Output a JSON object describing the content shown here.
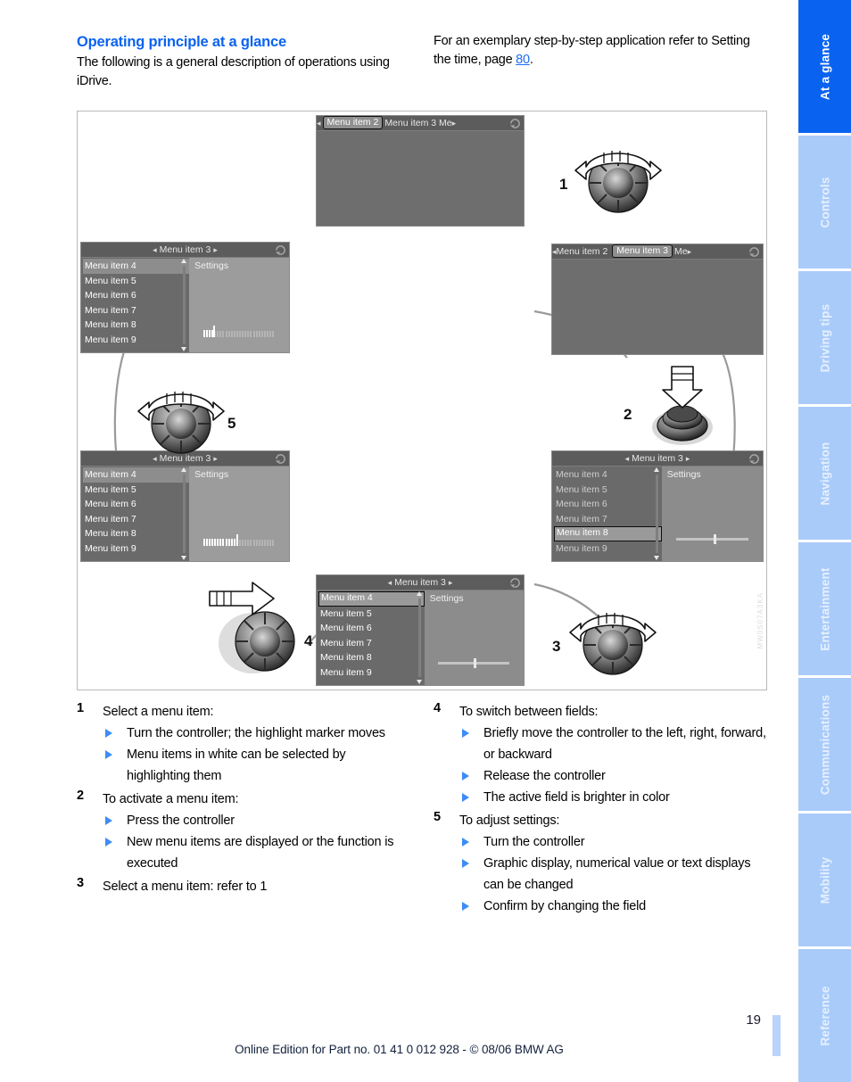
{
  "intro": {
    "heading": "Operating principle at a glance",
    "left_body": "The following is a general description of operations using iDrive.",
    "right_body_before": "For an exemplary step-by-step application refer to Setting the time, page ",
    "right_page_link": "80",
    "right_body_after": "."
  },
  "figure": {
    "watermark": "MW0S07A3KA",
    "screens": [
      {
        "id": "top-center",
        "type": "tab-bar",
        "tabs": [
          "Menu item 2",
          "Menu item 3",
          "Me"
        ],
        "selected_tab": "Menu item 2",
        "left_arrow": "◂",
        "right_arrow": "▸"
      },
      {
        "id": "mid-right",
        "type": "tab-bar",
        "tabs": [
          "Menu item 2",
          "Menu item 3",
          "Me"
        ],
        "selected_tab": "Menu item 3",
        "left_arrow": "◂",
        "right_arrow": "▸"
      },
      {
        "id": "bottom-right",
        "type": "list-detail",
        "title": "Menu item 3",
        "left_arrow": "◂",
        "right_arrow": "▸",
        "list": [
          "Menu item 4",
          "Menu item 5",
          "Menu item 6",
          "Menu item 7",
          "Menu item 8",
          "Menu item 9"
        ],
        "selected_list_item": "Menu item 8",
        "selection_style": "box",
        "detail_title": "Settings",
        "control": "slider",
        "slider_position_pct": 52,
        "detail_active": false
      },
      {
        "id": "bottom-center",
        "type": "list-detail",
        "title": "Menu item 3",
        "left_arrow": "◂",
        "right_arrow": "▸",
        "list": [
          "Menu item 4",
          "Menu item 5",
          "Menu item 6",
          "Menu item 7",
          "Menu item 8",
          "Menu item 9"
        ],
        "selected_list_item": "Menu item 4",
        "selection_style": "box",
        "detail_title": "Settings",
        "control": "slider",
        "slider_position_pct": 50,
        "detail_active": false
      },
      {
        "id": "bottom-left",
        "type": "list-detail",
        "title": "Menu item 3",
        "left_arrow": "◂",
        "right_arrow": "▸",
        "list": [
          "Menu item 4",
          "Menu item 5",
          "Menu item 6",
          "Menu item 7",
          "Menu item 8",
          "Menu item 9"
        ],
        "selected_list_item": "Menu item 4",
        "selection_style": "soft",
        "detail_title": "Settings",
        "control": "meter",
        "meter_filled_pct": 46,
        "detail_active": true
      },
      {
        "id": "mid-left",
        "type": "list-detail",
        "title": "Menu item 3",
        "left_arrow": "◂",
        "right_arrow": "▸",
        "list": [
          "Menu item 4",
          "Menu item 5",
          "Menu item 6",
          "Menu item 7",
          "Menu item 8",
          "Menu item 9"
        ],
        "selected_list_item": "Menu item 4",
        "selection_style": "soft",
        "detail_title": "Settings",
        "control": "meter",
        "meter_filled_pct": 14,
        "detail_active": true
      }
    ],
    "knobs": [
      {
        "id": "knob-1",
        "number": "1",
        "action": "turn"
      },
      {
        "id": "knob-2",
        "number": "2",
        "action": "press"
      },
      {
        "id": "knob-3",
        "number": "3",
        "action": "turn"
      },
      {
        "id": "knob-4",
        "number": "4",
        "action": "move-sideways"
      },
      {
        "id": "knob-5",
        "number": "5",
        "action": "turn"
      }
    ]
  },
  "steps": {
    "left": [
      {
        "number": "1",
        "title": "Select a menu item:",
        "bullets": [
          "Turn the controller; the highlight marker moves",
          "Menu items in white can be selected by highlighting them"
        ]
      },
      {
        "number": "2",
        "title": "To activate a menu item:",
        "bullets": [
          "Press the controller",
          "New menu items are displayed or the function is executed"
        ]
      },
      {
        "number": "3",
        "title": "Select a menu item: refer to 1",
        "bullets": []
      }
    ],
    "right": [
      {
        "number": "4",
        "title": "To switch between fields:",
        "bullets": [
          "Briefly move the controller to the left, right, forward, or backward",
          "Release the controller",
          "The active field is brighter in color"
        ]
      },
      {
        "number": "5",
        "title": "To adjust settings:",
        "bullets": [
          "Turn the controller",
          "Graphic display, numerical value or text displays can be changed",
          "Confirm by changing the field"
        ]
      }
    ]
  },
  "footer": {
    "page_number": "19",
    "text": "Online Edition for Part no. 01 41 0 012 928 - © 08/06 BMW AG"
  },
  "sidebar": {
    "tabs": [
      {
        "label": "At a glance",
        "active": true
      },
      {
        "label": "Controls",
        "active": false
      },
      {
        "label": "Driving tips",
        "active": false
      },
      {
        "label": "Navigation",
        "active": false
      },
      {
        "label": "Entertainment",
        "active": false
      },
      {
        "label": "Communications",
        "active": false
      },
      {
        "label": "Mobility",
        "active": false
      },
      {
        "label": "Reference",
        "active": false
      }
    ]
  },
  "colors": {
    "accent_blue": "#0a63f0",
    "tab_inactive": "#a9cbfa",
    "bullet_blue": "#3e8cf5",
    "screen_bg": "#6e6e6e"
  }
}
